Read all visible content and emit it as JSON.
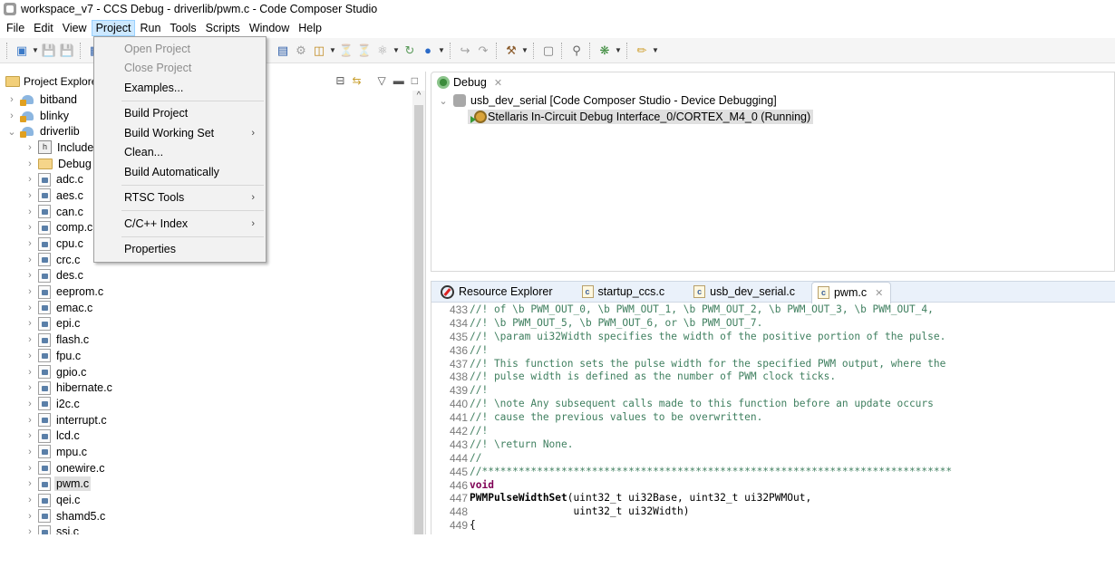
{
  "window": {
    "title": "workspace_v7 - CCS Debug - driverlib/pwm.c - Code Composer Studio"
  },
  "menubar": {
    "items": [
      "File",
      "Edit",
      "View",
      "Project",
      "Run",
      "Tools",
      "Scripts",
      "Window",
      "Help"
    ],
    "active": "Project"
  },
  "project_menu": {
    "items": [
      {
        "label": "Open Project",
        "enabled": false
      },
      {
        "label": "Close Project",
        "enabled": false
      },
      {
        "label": "Examples...",
        "enabled": true
      },
      {
        "label": "Build Project",
        "enabled": true
      },
      {
        "label": "Build Working Set",
        "enabled": true,
        "submenu": true
      },
      {
        "label": "Clean...",
        "enabled": true
      },
      {
        "label": "Build Automatically",
        "enabled": true
      },
      {
        "label": "RTSC Tools",
        "enabled": true,
        "submenu": true
      },
      {
        "label": "C/C++ Index",
        "enabled": true,
        "submenu": true
      },
      {
        "label": "Properties",
        "enabled": true
      }
    ],
    "submenu_arrow": "›"
  },
  "toolbar": {
    "icons": [
      "new-icon",
      "save-icon",
      "save-all-icon",
      "debug-view-icon",
      "target-config-icon",
      "build-config-icon",
      "load-program-icon",
      "breakpoint-icon",
      "hw-breakpoint-icon",
      "step-icon",
      "restart-icon",
      "global-var-icon",
      "step-into-icon",
      "step-over-icon",
      "build-hammer-icon",
      "open-perspective-icon",
      "search-icon",
      "debug-bug-icon",
      "external-tools-icon"
    ]
  },
  "project_explorer": {
    "title": "Project Explore",
    "tree": [
      {
        "label": "bitband",
        "type": "project",
        "depth": 0,
        "expanded": false
      },
      {
        "label": "blinky",
        "type": "project",
        "depth": 0,
        "expanded": false
      },
      {
        "label": "driverlib",
        "type": "project",
        "depth": 0,
        "expanded": true
      },
      {
        "label": "Include",
        "type": "includes",
        "depth": 1,
        "expanded": false
      },
      {
        "label": "Debug",
        "type": "folder",
        "depth": 1,
        "expanded": false
      },
      {
        "label": "adc.c",
        "type": "file",
        "depth": 1
      },
      {
        "label": "aes.c",
        "type": "file",
        "depth": 1
      },
      {
        "label": "can.c",
        "type": "file",
        "depth": 1
      },
      {
        "label": "comp.c",
        "type": "file",
        "depth": 1
      },
      {
        "label": "cpu.c",
        "type": "file",
        "depth": 1
      },
      {
        "label": "crc.c",
        "type": "file",
        "depth": 1
      },
      {
        "label": "des.c",
        "type": "file",
        "depth": 1
      },
      {
        "label": "eeprom.c",
        "type": "file",
        "depth": 1
      },
      {
        "label": "emac.c",
        "type": "file",
        "depth": 1
      },
      {
        "label": "epi.c",
        "type": "file",
        "depth": 1
      },
      {
        "label": "flash.c",
        "type": "file",
        "depth": 1
      },
      {
        "label": "fpu.c",
        "type": "file",
        "depth": 1
      },
      {
        "label": "gpio.c",
        "type": "file",
        "depth": 1
      },
      {
        "label": "hibernate.c",
        "type": "file",
        "depth": 1
      },
      {
        "label": "i2c.c",
        "type": "file",
        "depth": 1
      },
      {
        "label": "interrupt.c",
        "type": "file",
        "depth": 1
      },
      {
        "label": "lcd.c",
        "type": "file",
        "depth": 1
      },
      {
        "label": "mpu.c",
        "type": "file",
        "depth": 1
      },
      {
        "label": "onewire.c",
        "type": "file",
        "depth": 1
      },
      {
        "label": "pwm.c",
        "type": "file",
        "depth": 1,
        "selected": true
      },
      {
        "label": "qei.c",
        "type": "file",
        "depth": 1
      },
      {
        "label": "shamd5.c",
        "type": "file",
        "depth": 1
      },
      {
        "label": "ssi.c",
        "type": "file",
        "depth": 1
      }
    ]
  },
  "debug_view": {
    "tab_label": "Debug",
    "session": "usb_dev_serial [Code Composer Studio - Device Debugging]",
    "target": "Stellaris In-Circuit Debug Interface_0/CORTEX_M4_0 (Running)"
  },
  "editor": {
    "tabs": [
      {
        "label": "Resource Explorer",
        "icon": "compass-icon",
        "active": false
      },
      {
        "label": "startup_ccs.c",
        "icon": "c-file-icon",
        "active": false
      },
      {
        "label": "usb_dev_serial.c",
        "icon": "c-file-icon",
        "active": false
      },
      {
        "label": "pwm.c",
        "icon": "c-file-icon",
        "active": true,
        "closable": true
      }
    ],
    "lines": [
      {
        "n": "433",
        "text": "//! of \\b PWM_OUT_0, \\b PWM_OUT_1, \\b PWM_OUT_2, \\b PWM_OUT_3, \\b PWM_OUT_4,",
        "kind": "comment"
      },
      {
        "n": "434",
        "text": "//! \\b PWM_OUT_5, \\b PWM_OUT_6, or \\b PWM_OUT_7.",
        "kind": "comment"
      },
      {
        "n": "435",
        "text": "//! \\param ui32Width specifies the width of the positive portion of the pulse.",
        "kind": "comment"
      },
      {
        "n": "436",
        "text": "//!",
        "kind": "comment"
      },
      {
        "n": "437",
        "text": "//! This function sets the pulse width for the specified PWM output, where the",
        "kind": "comment"
      },
      {
        "n": "438",
        "text": "//! pulse width is defined as the number of PWM clock ticks.",
        "kind": "comment"
      },
      {
        "n": "439",
        "text": "//!",
        "kind": "comment"
      },
      {
        "n": "440",
        "text": "//! \\note Any subsequent calls made to this function before an update occurs",
        "kind": "comment"
      },
      {
        "n": "441",
        "text": "//! cause the previous values to be overwritten.",
        "kind": "comment"
      },
      {
        "n": "442",
        "text": "//!",
        "kind": "comment"
      },
      {
        "n": "443",
        "text": "//! \\return None.",
        "kind": "comment"
      },
      {
        "n": "444",
        "text": "//",
        "kind": "comment"
      },
      {
        "n": "445",
        "text": "//*****************************************************************************",
        "kind": "comment"
      },
      {
        "n": "446",
        "text": "void",
        "kind": "keyword"
      },
      {
        "n": "447",
        "text": "PWMPulseWidthSet(uint32_t ui32Base, uint32_t ui32PWMOut,",
        "kind": "func",
        "bold_prefix": "PWMPulseWidthSet"
      },
      {
        "n": "448",
        "text": "                 uint32_t ui32Width)",
        "kind": "code"
      },
      {
        "n": "449",
        "text": "{",
        "kind": "code"
      }
    ]
  }
}
